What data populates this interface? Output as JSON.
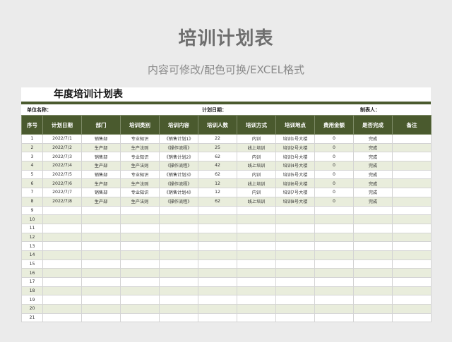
{
  "header": {
    "title": "培训计划表",
    "subtitle": "内容可修改/配色可换/EXCEL格式"
  },
  "sheet": {
    "title": "年度培训计划表",
    "unit_label": "单位名称：",
    "date_label": "计划日期：",
    "maker_label": "制表人："
  },
  "table": {
    "columns": [
      "序号",
      "计划日期",
      "部门",
      "培训类别",
      "培训内容",
      "培训人数",
      "培训方式",
      "培训地点",
      "费用金额",
      "是否完成",
      "备注"
    ],
    "rows": [
      [
        "1",
        "2022/7/1",
        "销售部",
        "专业知识",
        "《销售计划1》",
        "22",
        "内训",
        "培训1号大楼",
        "0",
        "完成",
        ""
      ],
      [
        "2",
        "2022/7/2",
        "生产部",
        "生产法则",
        "《操作流程》",
        "25",
        "线上培训",
        "培训2号大楼",
        "0",
        "完成",
        ""
      ],
      [
        "3",
        "2022/7/3",
        "销售部",
        "专业知识",
        "《销售计划2》",
        "62",
        "内训",
        "培训3号大楼",
        "0",
        "完成",
        ""
      ],
      [
        "4",
        "2022/7/4",
        "生产部",
        "生产法则",
        "《操作流程》",
        "42",
        "线上培训",
        "培训4号大楼",
        "0",
        "完成",
        ""
      ],
      [
        "5",
        "2022/7/5",
        "销售部",
        "专业知识",
        "《销售计划3》",
        "62",
        "内训",
        "培训5号大楼",
        "0",
        "完成",
        ""
      ],
      [
        "6",
        "2022/7/6",
        "生产部",
        "生产法则",
        "《操作流程》",
        "12",
        "线上培训",
        "培训6号大楼",
        "0",
        "完成",
        ""
      ],
      [
        "7",
        "2022/7/7",
        "销售部",
        "专业知识",
        "《销售计划4》",
        "12",
        "内训",
        "培训7号大楼",
        "0",
        "完成",
        ""
      ],
      [
        "8",
        "2022/7/8",
        "生产部",
        "生产法则",
        "《操作流程》",
        "62",
        "线上培训",
        "培训8号大楼",
        "0",
        "完成",
        ""
      ],
      [
        "9",
        "",
        "",
        "",
        "",
        "",
        "",
        "",
        "",
        "",
        ""
      ],
      [
        "10",
        "",
        "",
        "",
        "",
        "",
        "",
        "",
        "",
        "",
        ""
      ],
      [
        "11",
        "",
        "",
        "",
        "",
        "",
        "",
        "",
        "",
        "",
        ""
      ],
      [
        "12",
        "",
        "",
        "",
        "",
        "",
        "",
        "",
        "",
        "",
        ""
      ],
      [
        "13",
        "",
        "",
        "",
        "",
        "",
        "",
        "",
        "",
        "",
        ""
      ],
      [
        "14",
        "",
        "",
        "",
        "",
        "",
        "",
        "",
        "",
        "",
        ""
      ],
      [
        "15",
        "",
        "",
        "",
        "",
        "",
        "",
        "",
        "",
        "",
        ""
      ],
      [
        "16",
        "",
        "",
        "",
        "",
        "",
        "",
        "",
        "",
        "",
        ""
      ],
      [
        "17",
        "",
        "",
        "",
        "",
        "",
        "",
        "",
        "",
        "",
        ""
      ],
      [
        "18",
        "",
        "",
        "",
        "",
        "",
        "",
        "",
        "",
        "",
        ""
      ],
      [
        "19",
        "",
        "",
        "",
        "",
        "",
        "",
        "",
        "",
        "",
        ""
      ],
      [
        "20",
        "",
        "",
        "",
        "",
        "",
        "",
        "",
        "",
        "",
        ""
      ],
      [
        "21",
        "",
        "",
        "",
        "",
        "",
        "",
        "",
        "",
        "",
        ""
      ]
    ]
  },
  "colors": {
    "header_band": "#4a5a2e",
    "row_alt": "#e9eddc"
  }
}
